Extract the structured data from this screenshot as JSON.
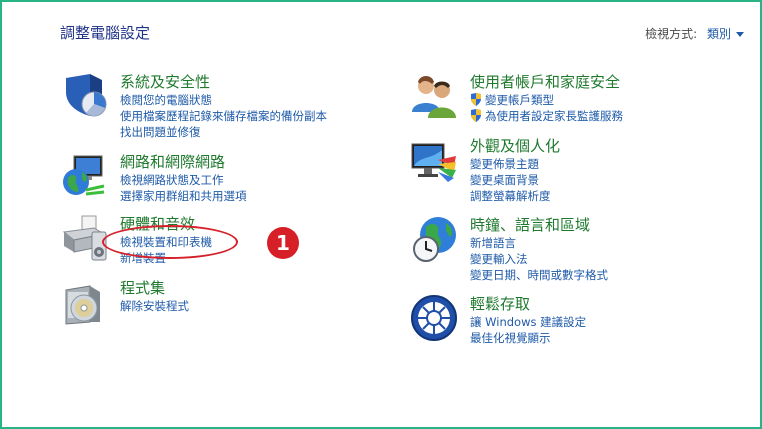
{
  "header": {
    "title": "調整電腦設定",
    "view_by_label": "檢視方式:",
    "view_by_value": "類別"
  },
  "categories": [
    {
      "title": "系統及安全性",
      "links": [
        "檢閱您的電腦狀態",
        "使用檔案歷程記錄來儲存檔案的備份副本",
        "找出問題並修復"
      ]
    },
    {
      "title": "網路和網際網路",
      "links": [
        "檢視網路狀態及工作",
        "選擇家用群組和共用選項"
      ]
    },
    {
      "title": "硬體和音效",
      "links": [
        "檢視裝置和印表機",
        "新增裝置"
      ]
    },
    {
      "title": "程式集",
      "links": [
        "解除安裝程式"
      ]
    },
    {
      "title": "使用者帳戶和家庭安全",
      "links": [
        "變更帳戶類型",
        "為使用者設定家長監護服務"
      ]
    },
    {
      "title": "外觀及個人化",
      "links": [
        "變更佈景主題",
        "變更桌面背景",
        "調整螢幕解析度"
      ]
    },
    {
      "title": "時鐘、語言和區域",
      "links": [
        "新增語言",
        "變更輸入法",
        "變更日期、時間或數字格式"
      ]
    },
    {
      "title": "輕鬆存取",
      "links": [
        "讓 Windows 建議設定",
        "最佳化視覺顯示"
      ]
    }
  ],
  "annotation": {
    "step_number": "1"
  },
  "colors": {
    "border": "#2bb388",
    "title": "#1e3287",
    "category": "#1f7a2e",
    "link": "#1e5aa8",
    "highlight": "#d61f26"
  }
}
